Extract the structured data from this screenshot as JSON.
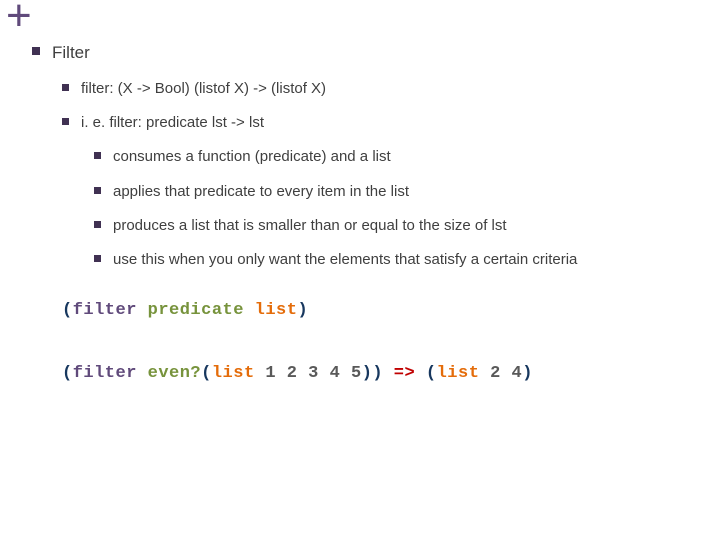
{
  "plus": "+",
  "l1": "Filter",
  "l2a": " filter: (X -> Bool) (listof X) -> (listof X)",
  "l2b": "i. e. filter: predicate lst -> lst",
  "l3a": "consumes a function (predicate) and a list",
  "l3b": "applies that predicate to every item in the list",
  "l3c": "produces a list that is smaller than or equal to the size of lst",
  "l3d": "use this when you only want the elements that satisfy a certain criteria",
  "code1": {
    "p1": "(",
    "p2": "filter",
    "p3": " ",
    "p4": "predicate",
    "p5": " ",
    "p6": "list",
    "p7": ")"
  },
  "code2": {
    "p1": "(",
    "p2": "filter",
    "p3": " ",
    "p4": "even?",
    "p5": "(",
    "p6": "list",
    "p7": " 1 2 3 4 5",
    "p8": ")) ",
    "p9": "=>",
    "p10": " (",
    "p11": "list",
    "p12": " 2 4",
    "p13": ")"
  }
}
